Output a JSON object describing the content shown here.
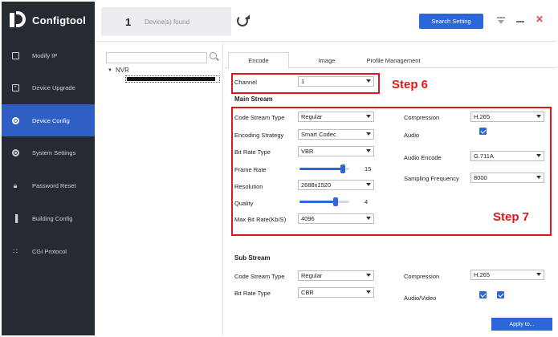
{
  "app": {
    "title": "Configtool"
  },
  "sidebar": {
    "items": [
      {
        "label": "Modify IP",
        "icon": "modify-ip-icon",
        "active": false
      },
      {
        "label": "Device Upgrade",
        "icon": "upgrade-icon",
        "active": false
      },
      {
        "label": "Device Config",
        "icon": "config-icon",
        "active": true
      },
      {
        "label": "System Settings",
        "icon": "settings-icon",
        "active": false
      },
      {
        "label": "Password Reset",
        "icon": "lock-icon",
        "active": false
      },
      {
        "label": "Building Config",
        "icon": "building-icon",
        "active": false
      },
      {
        "label": "CGI Protocol",
        "icon": "protocol-icon",
        "active": false
      }
    ]
  },
  "topbar": {
    "device_count": "1",
    "devices_found_label": "Device(s) found",
    "search_setting_label": "Search Setting"
  },
  "tree": {
    "root_label": "NVR"
  },
  "tabs": [
    {
      "label": "Encode",
      "active": true
    },
    {
      "label": "Image",
      "active": false
    },
    {
      "label": "Profile Management",
      "active": false
    }
  ],
  "channel": {
    "label": "Channel",
    "value": "1"
  },
  "main_stream": {
    "title": "Main Stream",
    "code_stream_type": {
      "label": "Code Stream Type",
      "value": "Regular"
    },
    "encoding_strategy": {
      "label": "Encoding Strategy",
      "value": "Smart Codec"
    },
    "bit_rate_type": {
      "label": "Bit Rate Type",
      "value": "VBR"
    },
    "frame_rate": {
      "label": "Frame Rate",
      "value": "15",
      "level": 0.87
    },
    "resolution": {
      "label": "Resolution",
      "value": "2688x1520"
    },
    "quality": {
      "label": "Quality",
      "value": "4",
      "level": 0.72
    },
    "max_bit_rate": {
      "label": "Max Bit Rate(Kb/S)",
      "value": "4096"
    },
    "compression": {
      "label": "Compression",
      "value": "H.265"
    },
    "audio": {
      "label": "Audio",
      "checked": true
    },
    "audio_encode": {
      "label": "Audio Encode",
      "value": "G.711A"
    },
    "sampling_frequency": {
      "label": "Sampling Frequency",
      "value": "8000"
    }
  },
  "sub_stream": {
    "title": "Sub Stream",
    "code_stream_type": {
      "label": "Code Stream Type",
      "value": "Regular"
    },
    "bit_rate_type": {
      "label": "Bit Rate Type",
      "value": "CBR"
    },
    "compression": {
      "label": "Compression",
      "value": "H.265"
    },
    "audio_video": {
      "label": "Audio/Video",
      "checked": [
        true,
        true
      ]
    }
  },
  "apply_label": "Apply to...",
  "annotations": {
    "step6": "Step 6",
    "step7": "Step 7",
    "color": "#e4161b"
  },
  "colors": {
    "sidebar_bg": "#262a31",
    "accent": "#2c66d8",
    "active_nav": "#2f5fc4"
  }
}
